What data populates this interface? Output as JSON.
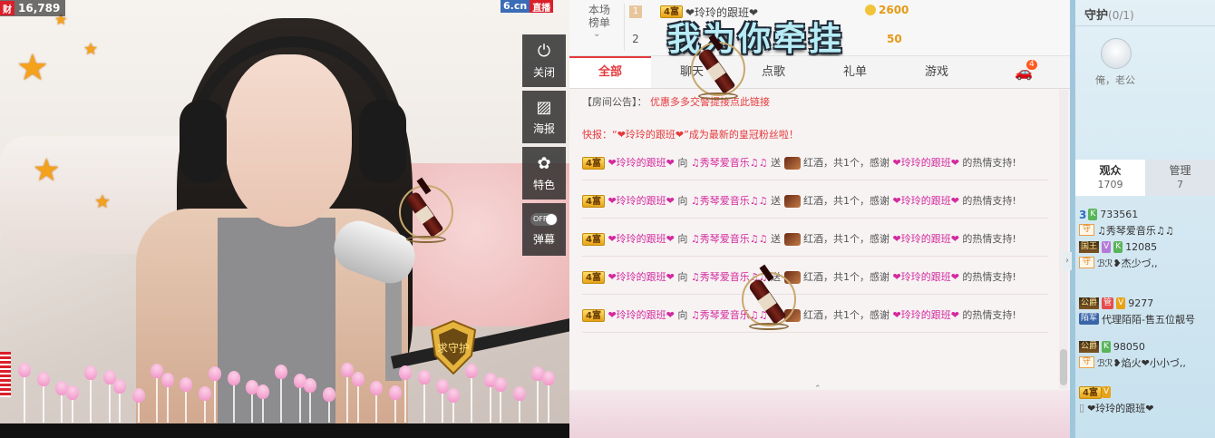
{
  "video": {
    "viewer_count": "16,789",
    "cai_label": "财",
    "logo_left": "6.cn",
    "logo_right": "直播",
    "tools": [
      {
        "icon": "power-icon",
        "glyph": "⏻",
        "label": "关闭"
      },
      {
        "icon": "poster-icon",
        "glyph": "▨",
        "label": "海报"
      },
      {
        "icon": "effects-icon",
        "glyph": "✿",
        "label": "特色"
      },
      {
        "icon": "danmaku-toggle",
        "glyph": "",
        "label": "弹幕",
        "toggle_text": "OFF"
      }
    ]
  },
  "rank": {
    "label_line1": "本场",
    "label_line2": "榜单",
    "rows": [
      {
        "rank": "1",
        "level": "4富",
        "name": "❤玲玲的跟班❤",
        "coins": "2600"
      },
      {
        "rank": "2",
        "coins": "50"
      }
    ],
    "banner_text": "我为你牵挂"
  },
  "tabs": [
    {
      "label": "全部",
      "active": true
    },
    {
      "label": "聊天"
    },
    {
      "label": "点歌"
    },
    {
      "label": "礼单"
    },
    {
      "label": "游戏"
    },
    {
      "label": "",
      "icon": "car-icon",
      "count": "4"
    }
  ],
  "chat": {
    "notice_label": "【房间公告】：",
    "notice_text": "优惠多多交警提接点此链接",
    "flash_text": "快报：“❤玲玲的跟班❤”成为最新的皇冠粉丝啦！",
    "messages": [
      {
        "level": "4富",
        "sender": "❤玲玲的跟班❤",
        "to_word": "向",
        "receiver": "♫秀琴爱音乐♫♫",
        "send_word": "送",
        "gift": "红酒，共1个，感谢",
        "thanks_name": "❤玲玲的跟班❤",
        "tail": "的热情支持!"
      },
      {
        "level": "4富",
        "sender": "❤玲玲的跟班❤",
        "to_word": "向",
        "receiver": "♫秀琴爱音乐♫♫",
        "send_word": "送",
        "gift": "红酒，共1个，感谢",
        "thanks_name": "❤玲玲的跟班❤",
        "tail": "的热情支持!"
      },
      {
        "level": "4富",
        "sender": "❤玲玲的跟班❤",
        "to_word": "向",
        "receiver": "♫秀琴爱音乐♫♫",
        "send_word": "送",
        "gift": "红酒，共1个，感谢",
        "thanks_name": "❤玲玲的跟班❤",
        "tail": "的热情支持!"
      },
      {
        "level": "4富",
        "sender": "❤玲玲的跟班❤",
        "to_word": "向",
        "receiver": "♫秀琴爱音乐♫♫",
        "send_word": "送",
        "gift": "红酒，共1个，感谢",
        "thanks_name": "❤玲玲的跟班❤",
        "tail": "的热情支持!"
      },
      {
        "level": "4富",
        "sender": "❤玲玲的跟班❤",
        "to_word": "向",
        "receiver": "♫秀琴爱音乐♫♫",
        "send_word": "送",
        "gift": "红酒，共1个，感谢",
        "thanks_name": "❤玲玲的跟班❤",
        "tail": "的热情支持!"
      }
    ]
  },
  "sidebar": {
    "guard_title": "守护",
    "guard_count": "(0/1)",
    "guard_name": "俺，老公",
    "tabs": [
      {
        "label": "观众",
        "count": "1709",
        "active": true
      },
      {
        "label": "管理",
        "count": "7"
      }
    ],
    "audience": [
      {
        "prefix": "3",
        "badge": "K",
        "badge_class": "bk",
        "id": "733561",
        "tag": "守",
        "tag_type": "guard",
        "name": "♫秀琴爱音乐♫♫"
      },
      {
        "prefix": "国王",
        "badge2": "V",
        "badge": "K",
        "badge_class": "bk",
        "id": "12085",
        "tag": "守",
        "tag_type": "guard",
        "name": "ℬℛ❥杰少づ,,"
      },
      {
        "prefix": "公爵",
        "badge2": "管",
        "badge": "V",
        "badge_class": "bvo",
        "id": "9277",
        "tag": "陌军",
        "tag_type": "group",
        "name": "代理陌陌-售五位靓号"
      },
      {
        "prefix": "公爵",
        "badge": "K",
        "badge_class": "bk",
        "id": "98050",
        "tag": "守",
        "tag_type": "guard",
        "name": "ℬℛ❥焰火❤小小づ,,"
      },
      {
        "prefix": "4富",
        "badge": "V",
        "badge_class": "bvo",
        "id": "",
        "tag": "",
        "tag_type": "phone",
        "name": "❤玲玲的跟班❤"
      }
    ]
  }
}
